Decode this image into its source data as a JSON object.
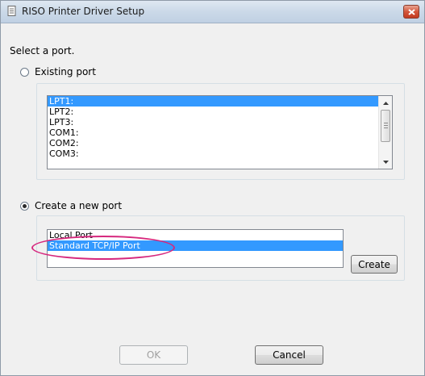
{
  "window": {
    "title": "RISO Printer Driver Setup"
  },
  "prompt": "Select a port.",
  "existing_port": {
    "label": "Existing port",
    "checked": false,
    "items": [
      "LPT1:",
      "LPT2:",
      "LPT3:",
      "COM1:",
      "COM2:",
      "COM3:"
    ],
    "selected_index": 0
  },
  "new_port": {
    "label": "Create a new port",
    "checked": true,
    "items": [
      "Local Port",
      "Standard TCP/IP Port"
    ],
    "selected_index": 1,
    "create_label": "Create"
  },
  "buttons": {
    "ok": "OK",
    "cancel": "Cancel"
  },
  "colors": {
    "selection": "#3399ff",
    "annotation": "#d6287e"
  }
}
